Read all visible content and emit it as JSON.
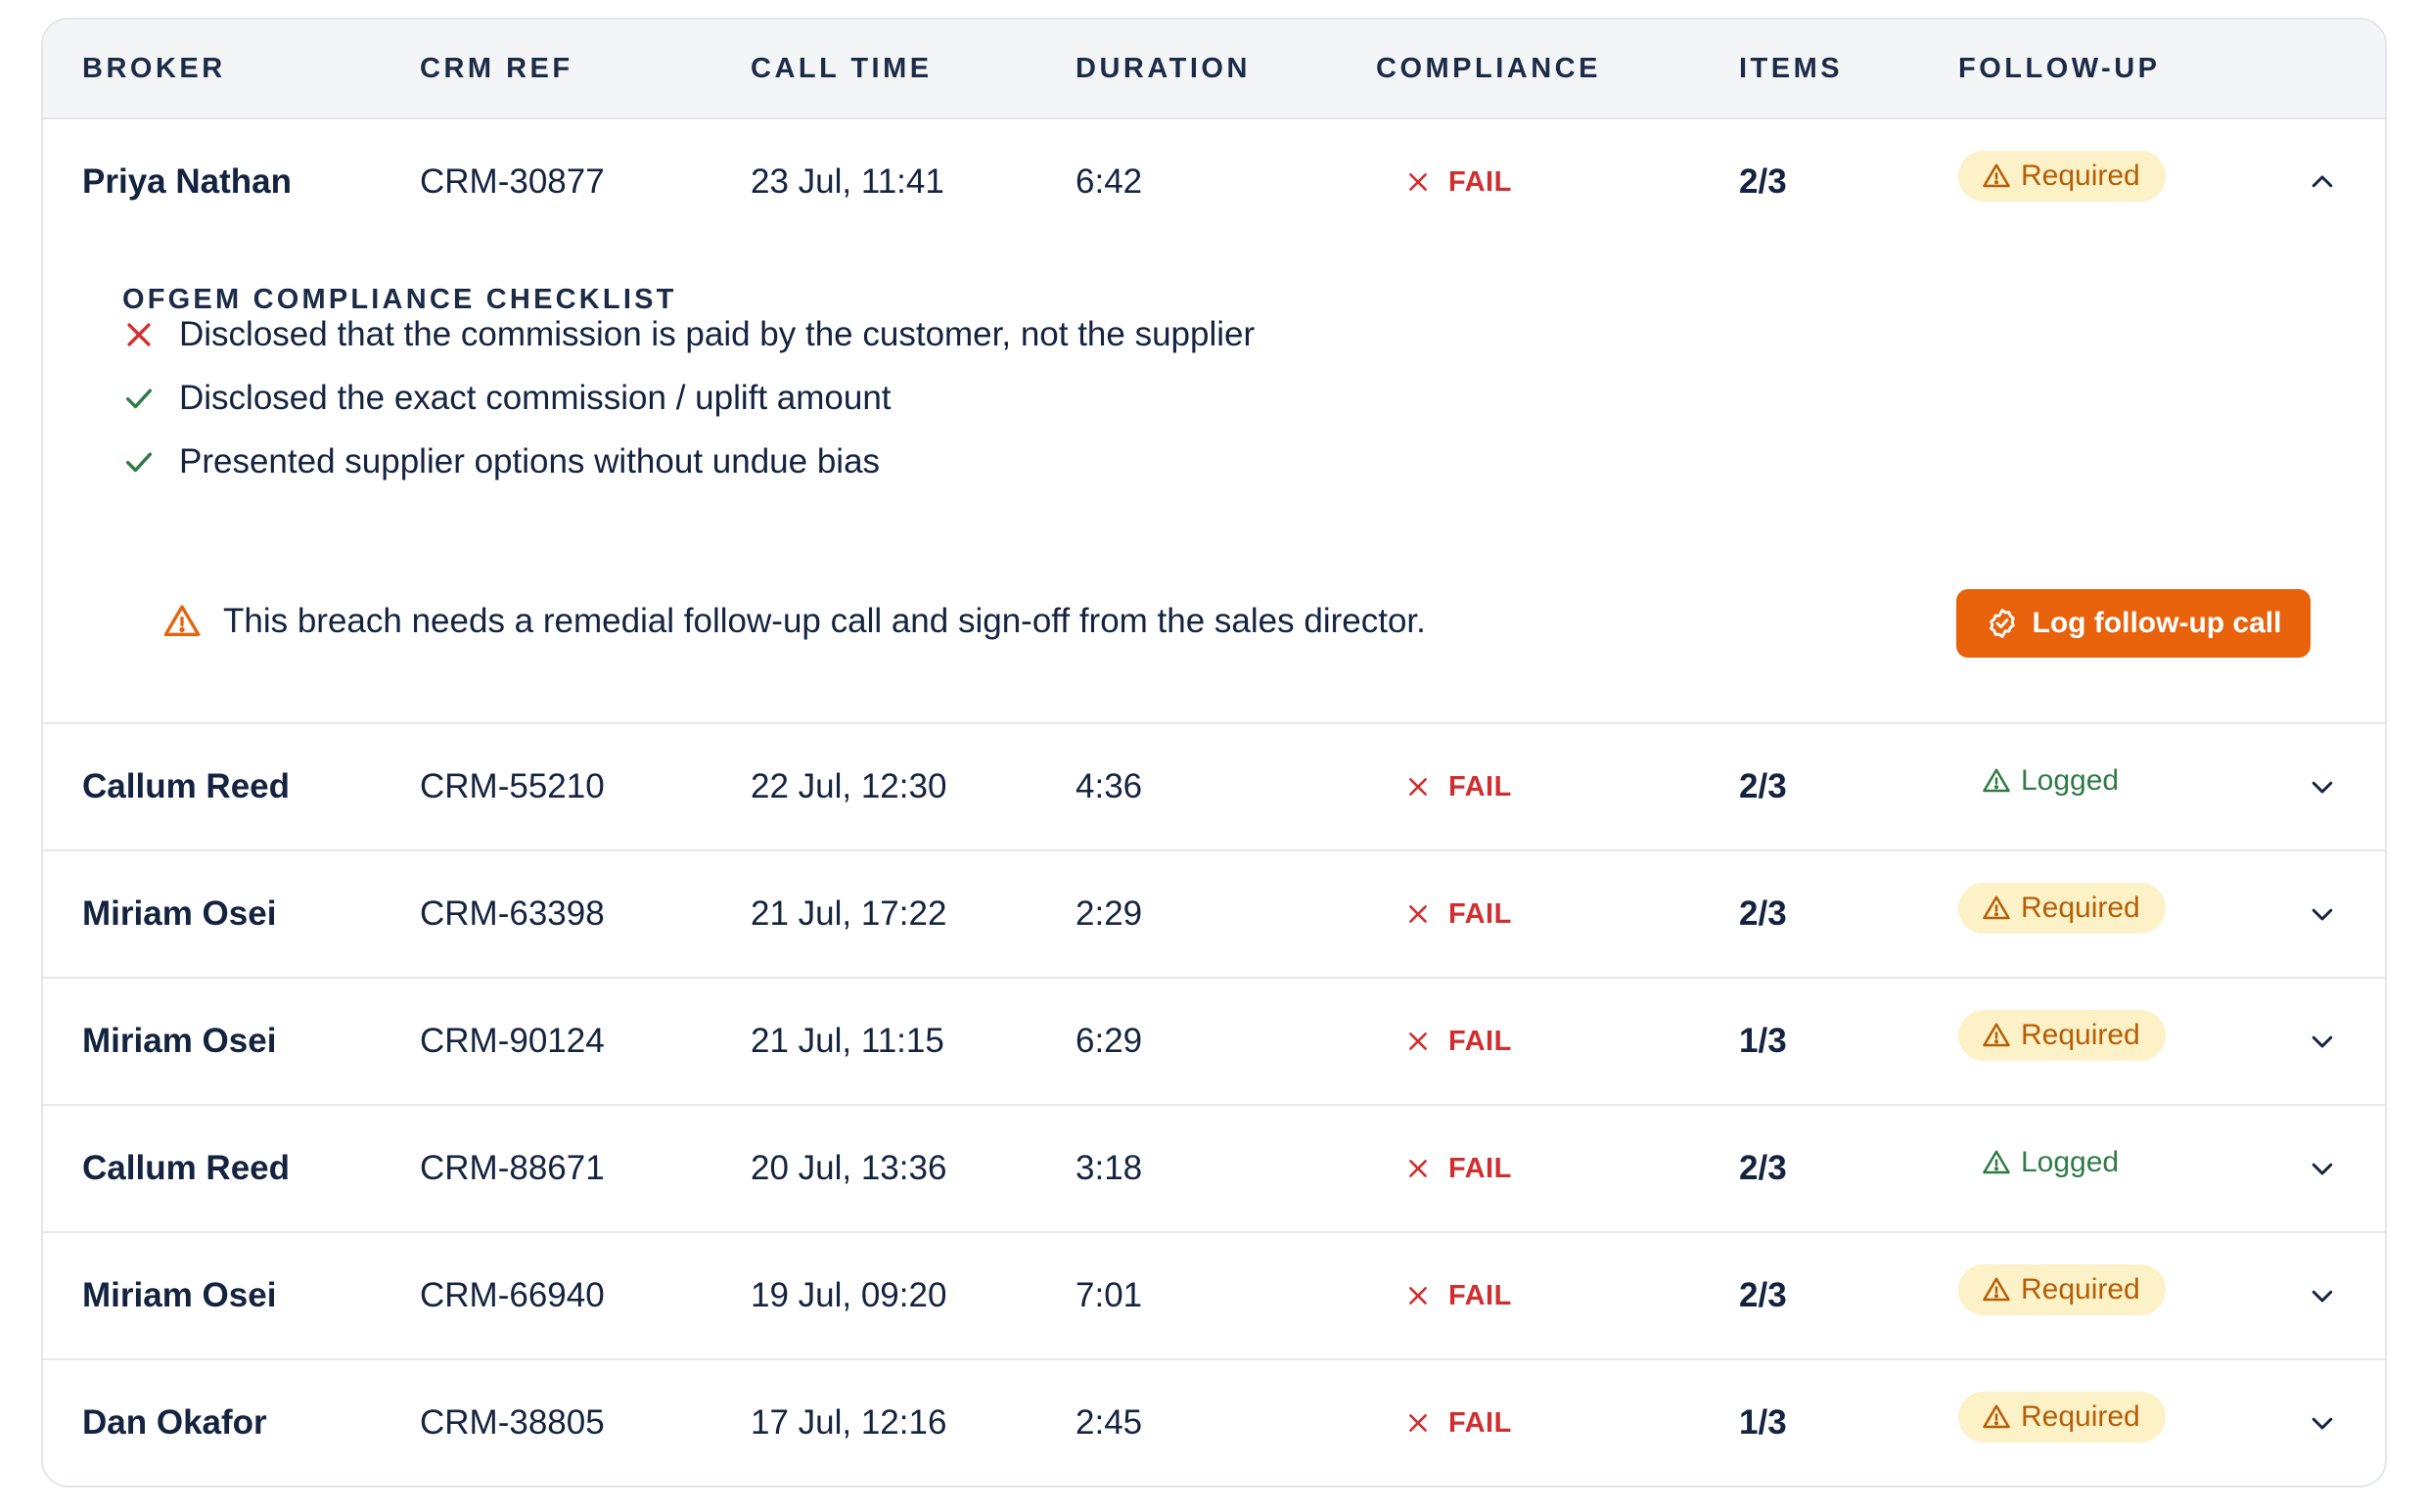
{
  "columns": {
    "broker": "BROKER",
    "crm_ref": "CRM REF",
    "call_time": "CALL TIME",
    "duration": "DURATION",
    "compliance": "COMPLIANCE",
    "items": "ITEMS",
    "follow_up": "FOLLOW-UP"
  },
  "rows": [
    {
      "broker": "Priya Nathan",
      "crm_ref": "CRM-30877",
      "call_time": "23 Jul, 11:41",
      "duration": "6:42",
      "compliance": "FAIL",
      "items": "2/3",
      "follow_up": "Required",
      "expanded": true
    },
    {
      "broker": "Callum Reed",
      "crm_ref": "CRM-55210",
      "call_time": "22 Jul, 12:30",
      "duration": "4:36",
      "compliance": "FAIL",
      "items": "2/3",
      "follow_up": "Logged",
      "expanded": false
    },
    {
      "broker": "Miriam Osei",
      "crm_ref": "CRM-63398",
      "call_time": "21 Jul, 17:22",
      "duration": "2:29",
      "compliance": "FAIL",
      "items": "2/3",
      "follow_up": "Required",
      "expanded": false
    },
    {
      "broker": "Miriam Osei",
      "crm_ref": "CRM-90124",
      "call_time": "21 Jul, 11:15",
      "duration": "6:29",
      "compliance": "FAIL",
      "items": "1/3",
      "follow_up": "Required",
      "expanded": false
    },
    {
      "broker": "Callum Reed",
      "crm_ref": "CRM-88671",
      "call_time": "20 Jul, 13:36",
      "duration": "3:18",
      "compliance": "FAIL",
      "items": "2/3",
      "follow_up": "Logged",
      "expanded": false
    },
    {
      "broker": "Miriam Osei",
      "crm_ref": "CRM-66940",
      "call_time": "19 Jul, 09:20",
      "duration": "7:01",
      "compliance": "FAIL",
      "items": "2/3",
      "follow_up": "Required",
      "expanded": false
    },
    {
      "broker": "Dan Okafor",
      "crm_ref": "CRM-38805",
      "call_time": "17 Jul, 12:16",
      "duration": "2:45",
      "compliance": "FAIL",
      "items": "1/3",
      "follow_up": "Required",
      "expanded": false
    }
  ],
  "checklist": {
    "title": "OFGEM COMPLIANCE CHECKLIST",
    "items": [
      {
        "text": "Disclosed that the commission is paid by the customer, not the supplier",
        "passed": false
      },
      {
        "text": "Disclosed the exact commission / uplift amount",
        "passed": true
      },
      {
        "text": "Presented supplier options without undue bias",
        "passed": true
      }
    ],
    "warning": "This breach needs a remedial follow-up call and sign-off from the sales director.",
    "action_label": "Log follow-up call"
  },
  "colors": {
    "fail": "#d12f2f",
    "pass": "#2f7a46",
    "required_bg": "#fdf1c7",
    "required_text": "#b45f06",
    "logged_text": "#2f7a46",
    "action": "#e8620c"
  },
  "icons": {
    "fail": "x-icon",
    "pass": "check-icon",
    "warning": "warning-triangle-icon",
    "expand": "chevron-down-icon",
    "collapse": "chevron-up-icon",
    "action": "check-circle-icon"
  }
}
